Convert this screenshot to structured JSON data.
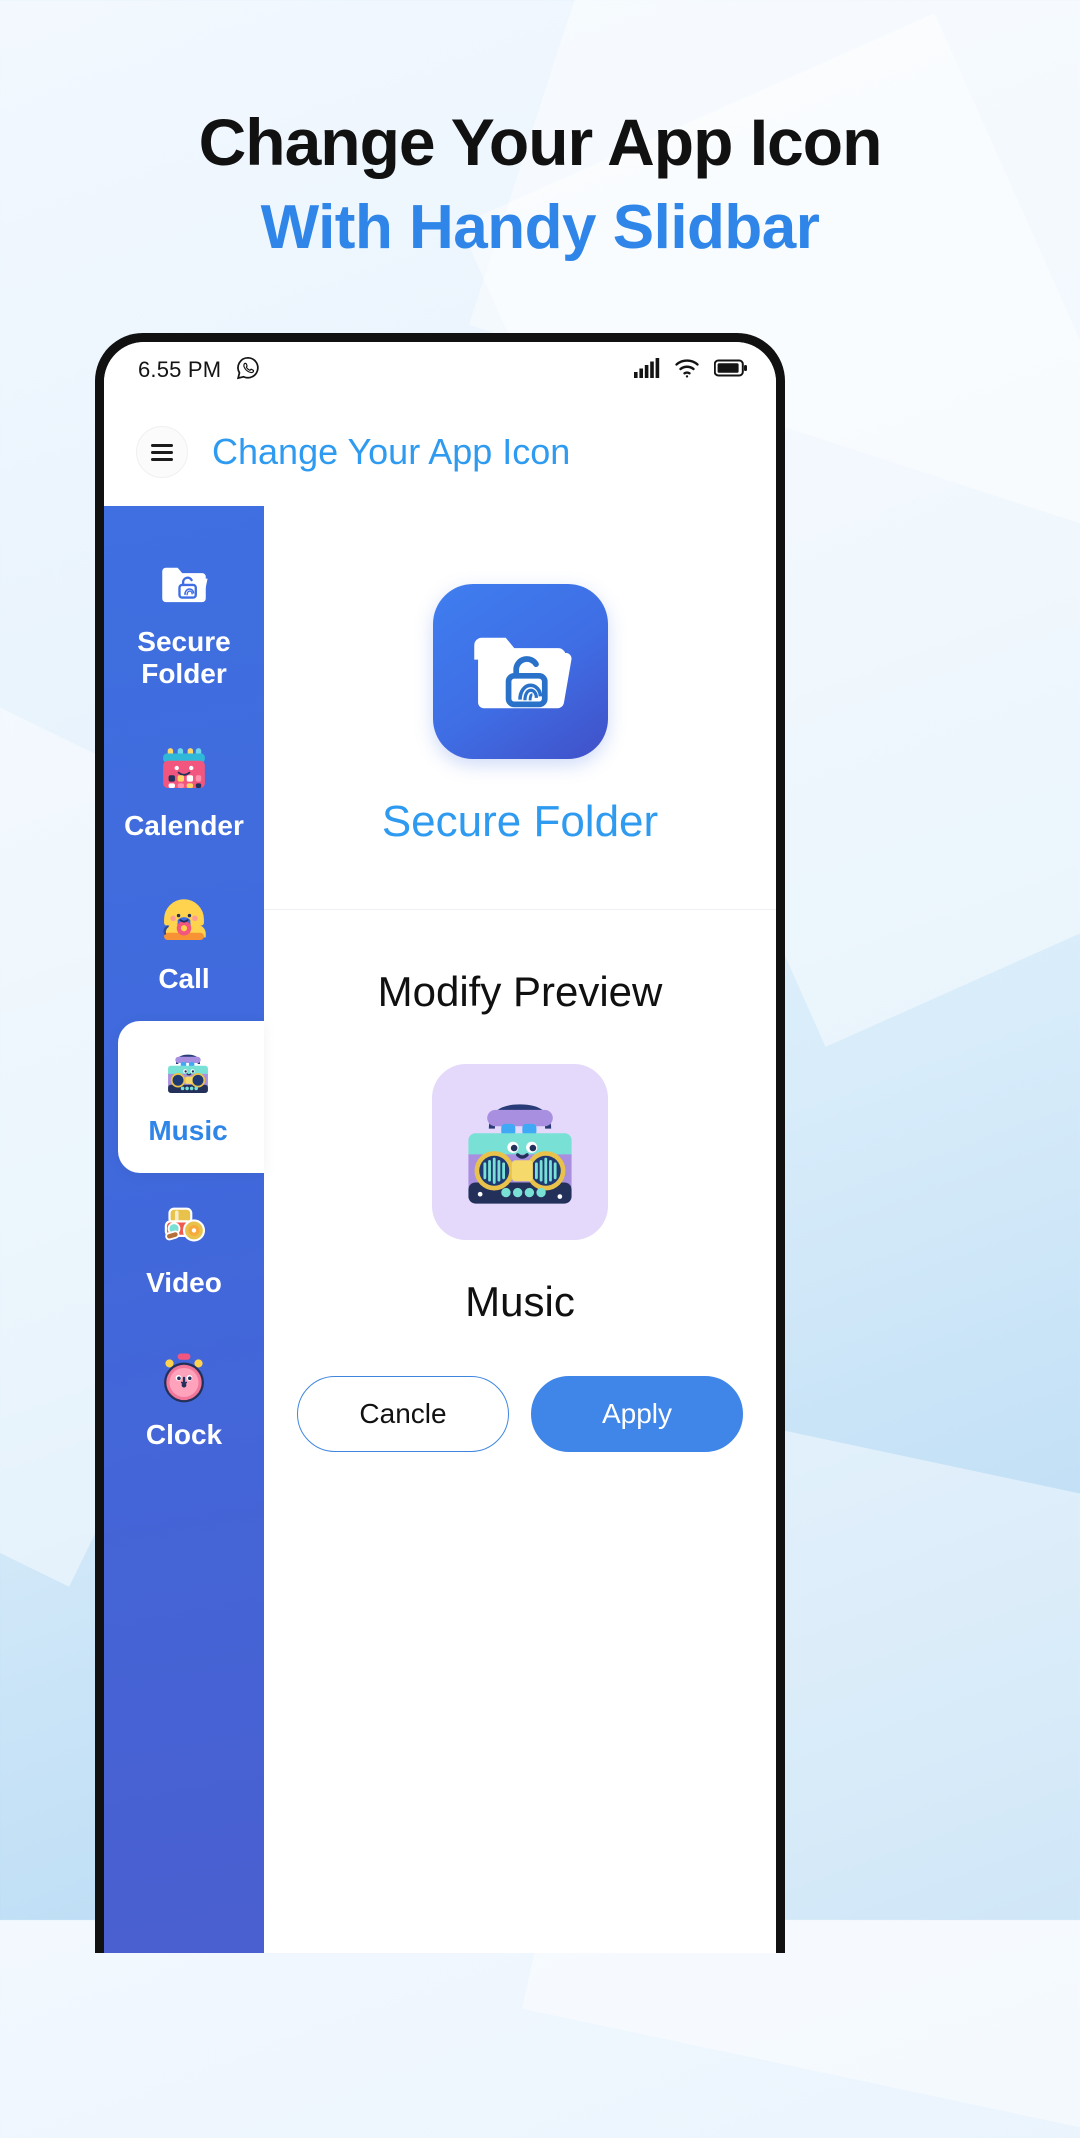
{
  "promo": {
    "line1": "Change Your App Icon",
    "line2": "With Handy Slidbar",
    "line1_color": "#111111",
    "line2_color": "#2f86e8"
  },
  "statusbar": {
    "time": "6.55 PM",
    "icons": [
      "whatsapp-icon",
      "signal-icon",
      "wifi-icon",
      "battery-icon"
    ]
  },
  "appbar": {
    "menu_icon": "hamburger-menu-icon",
    "title": "Change Your App Icon",
    "title_color": "#2f9bf0"
  },
  "sidebar": {
    "background_color": "#4069dc",
    "items": [
      {
        "label": "Secure Folder",
        "icon": "secure-folder-icon",
        "active": false
      },
      {
        "label": "Calender",
        "icon": "calendar-icon",
        "active": false
      },
      {
        "label": "Call",
        "icon": "telephone-icon",
        "active": false
      },
      {
        "label": "Music",
        "icon": "radio-icon",
        "active": true
      },
      {
        "label": "Video",
        "icon": "film-camera-icon",
        "active": false
      },
      {
        "label": "Clock",
        "icon": "stopwatch-icon",
        "active": false
      }
    ]
  },
  "current": {
    "icon": "secure-folder-app-icon",
    "name": "Secure Folder",
    "name_color": "#2f9bf0",
    "icon_bg": "#3f6de4"
  },
  "modify": {
    "title": "Modify Preview",
    "preview_icon": "radio-icon",
    "preview_icon_bg": "#e4d9fb",
    "preview_name": "Music"
  },
  "actions": {
    "cancel_label": "Cancle",
    "apply_label": "Apply",
    "apply_color": "#3f86e8"
  }
}
